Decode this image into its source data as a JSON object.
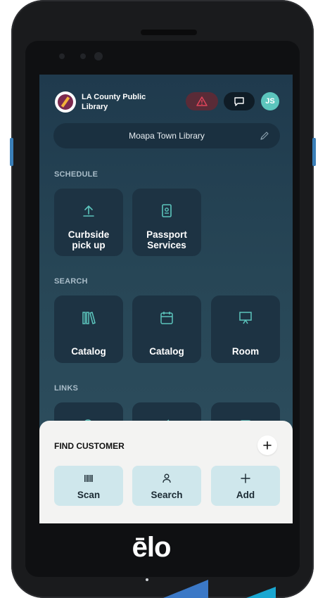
{
  "header": {
    "org_name": "LA County Public Library",
    "avatar_initials": "JS"
  },
  "location": {
    "name": "Moapa Town Library"
  },
  "schedule": {
    "label": "SCHEDULE",
    "items": [
      {
        "label": "Curbside pick up",
        "icon": "upload-icon"
      },
      {
        "label": "Passport Services",
        "icon": "passport-icon"
      }
    ]
  },
  "search": {
    "label": "SEARCH",
    "items": [
      {
        "label": "Catalog",
        "icon": "books-icon"
      },
      {
        "label": "Catalog",
        "icon": "calendar-icon"
      },
      {
        "label": "Room",
        "icon": "presentation-icon"
      }
    ]
  },
  "links": {
    "label": "LINKS"
  },
  "find_customer": {
    "title": "FIND CUSTOMER",
    "actions": [
      {
        "label": "Scan",
        "icon": "barcode-icon"
      },
      {
        "label": "Search",
        "icon": "person-icon"
      },
      {
        "label": "Add",
        "icon": "plus-icon"
      }
    ]
  },
  "device": {
    "brand": "ēlo"
  },
  "colors": {
    "accent": "#5cc5bd",
    "alert": "#e0445a",
    "tile": "#1d3343",
    "action_button": "#cfe7ec"
  }
}
